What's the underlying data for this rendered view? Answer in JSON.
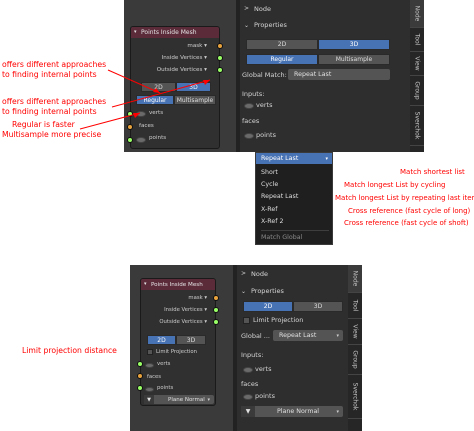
{
  "top": {
    "node_title": "Points Inside Mesh",
    "rows": {
      "mask": "mask",
      "inside": "Inside Vertices",
      "outside": "Outside Vertices"
    },
    "mode_2d": "2D",
    "mode_3d": "3D",
    "regular": "Regular",
    "multisample": "Multisample",
    "inputs": [
      "verts",
      "faces",
      "points"
    ],
    "panel": {
      "node_header": "Node",
      "properties_header": "Properties",
      "btn_2d": "2D",
      "btn_3d": "3D",
      "regular": "Regular",
      "multisample": "Multisample",
      "global_match_label": "Global Match:",
      "global_match_value": "Repeat Last",
      "inputs_label": "Inputs:",
      "verts": "verts",
      "faces": "faces",
      "points": "points"
    },
    "tabs": [
      "Node",
      "Tool",
      "View",
      "Group",
      "Sverchok"
    ],
    "dropdown": {
      "selected": "Repeat Last",
      "items": [
        "Short",
        "Cycle",
        "Repeat Last",
        "X-Ref",
        "X-Ref 2"
      ],
      "footer": "Match Global"
    }
  },
  "bottom": {
    "node_title": "Points Inside Mesh",
    "rows": {
      "mask": "mask",
      "inside": "Inside Vertices",
      "outside": "Outside Vertices"
    },
    "mode_2d": "2D",
    "mode_3d": "3D",
    "limit_projection": "Limit Projection",
    "inputs": [
      "verts",
      "faces",
      "points"
    ],
    "plane_normal": "Plane Normal",
    "panel": {
      "node_header": "Node",
      "properties_header": "Properties",
      "btn_2d": "2D",
      "btn_3d": "3D",
      "limit_projection": "Limit Projection",
      "global_label": "Global ...",
      "global_value": "Repeat Last",
      "inputs_label": "Inputs:",
      "verts": "verts",
      "faces": "faces",
      "points": "points",
      "plane_normal": "Plane Normal"
    },
    "tabs": [
      "Node",
      "Tool",
      "View",
      "Group",
      "Sverchok"
    ]
  },
  "annotations": {
    "a1": "offers different approaches",
    "a2": "to finding internal points",
    "a3": "offers different approaches",
    "a4": "to finding internal points",
    "a5": "Regular is faster",
    "a6": "Multisample more precise",
    "m1": "Match shortest list",
    "m2": "Match longest List by cycling",
    "m3": "Match longest List by repeating last item",
    "m4": "Cross reference (fast cycle of long)",
    "m5": "Cross reference (fast cycle of shoft)",
    "limit": "Limit projection distance"
  },
  "colors": {
    "annotation": "#ff0000",
    "active_button": "#4772b3",
    "node_header": "#5b2b3a",
    "vector_socket": "#99ff66",
    "string_socket": "#e8a33d"
  }
}
